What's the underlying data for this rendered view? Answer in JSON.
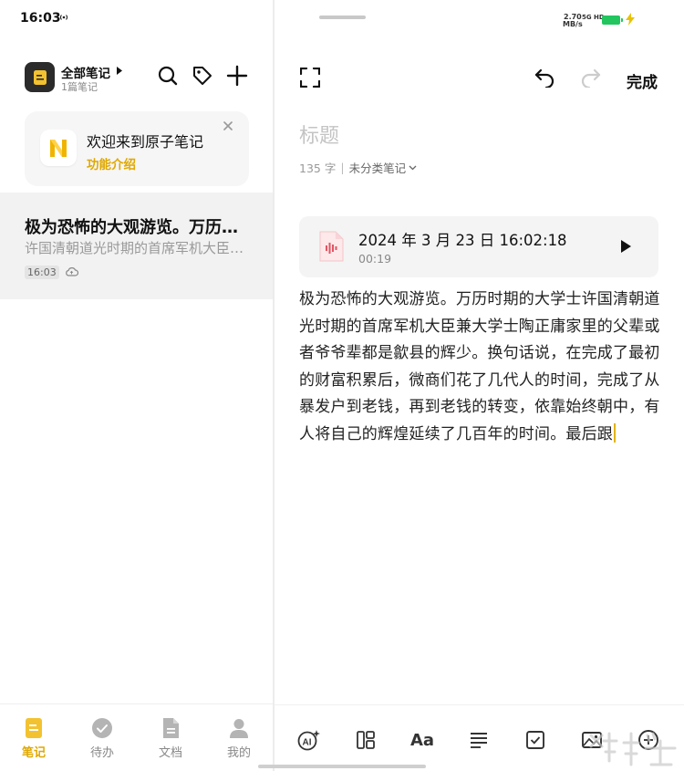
{
  "status_bar": {
    "time": "16:03",
    "net_speed_value": "2.70",
    "net_speed_unit": "MB/s",
    "network_type": "5G HD",
    "battery_color": "#22c55e"
  },
  "sidebar": {
    "notebook_title": "全部笔记",
    "notebook_count": "1篇笔记",
    "icons": [
      "search-icon",
      "tag-icon",
      "plus-icon"
    ],
    "welcome_card": {
      "title": "欢迎来到原子笔记",
      "link": "功能介绍",
      "logo_icon": "atom-notes-logo"
    },
    "notes": [
      {
        "title": "极为恐怖的大观游览。万历时期的大学士许国清朝道光时期的首席军机大臣",
        "snippet": "许国清朝道光时期的首席军机大臣兼大学士陶正庸家里",
        "time": "16:03"
      }
    ]
  },
  "bottom_nav": {
    "items": [
      {
        "label": "笔记",
        "icon": "note-icon",
        "active": true
      },
      {
        "label": "待办",
        "icon": "check-circle-icon",
        "active": false
      },
      {
        "label": "文档",
        "icon": "document-icon",
        "active": false
      },
      {
        "label": "我的",
        "icon": "profile-icon",
        "active": false
      }
    ]
  },
  "editor": {
    "done_label": "完成",
    "title_placeholder": "标题",
    "char_count": "135 字",
    "category": "未分类笔记",
    "audio": {
      "date": "2024 年 3 月 23 日 16:02:18",
      "duration": "00:19"
    },
    "body": "极为恐怖的大观游览。万历时期的大学士许国清朝道光时期的首席军机大臣兼大学士陶正庸家里的父辈或者爷爷辈都是歙县的辉少。换句话说，在完成了最初的财富积累后，微商们花了几代人的时间，完成了从暴发户到老钱，再到老钱的转变，依靠始终朝中，有人将自己的辉煌延续了几百年的时间。最后跟"
  },
  "editor_toolbar": {
    "aa_label": "Aa",
    "icons": [
      "ai-sparkle-icon",
      "layout-icon",
      "text-format-icon",
      "align-icon",
      "checkbox-icon",
      "image-icon",
      "add-icon"
    ]
  },
  "accent_color": "#e0a800"
}
